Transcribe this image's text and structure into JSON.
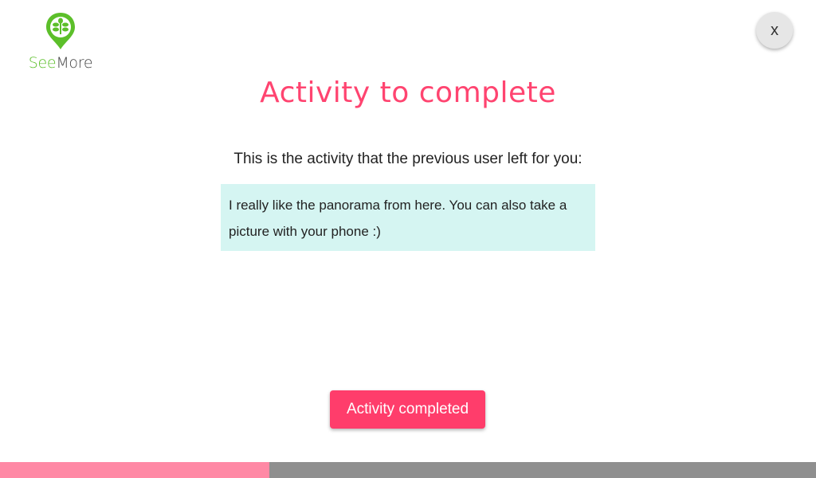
{
  "logo": {
    "text_see": "See",
    "text_more": "More"
  },
  "close_label": "x",
  "title": "Activity to complete",
  "intro": "This is the activity that the previous user left for you:",
  "activity_text": "I really like the panorama from here. You can also take a picture with your phone :)",
  "complete_button": "Activity completed",
  "progress": {
    "percent": 33
  },
  "colors": {
    "accent": "#ff3d6b",
    "brand_green": "#5cbf2a",
    "note_bg": "#d5f5f2"
  }
}
